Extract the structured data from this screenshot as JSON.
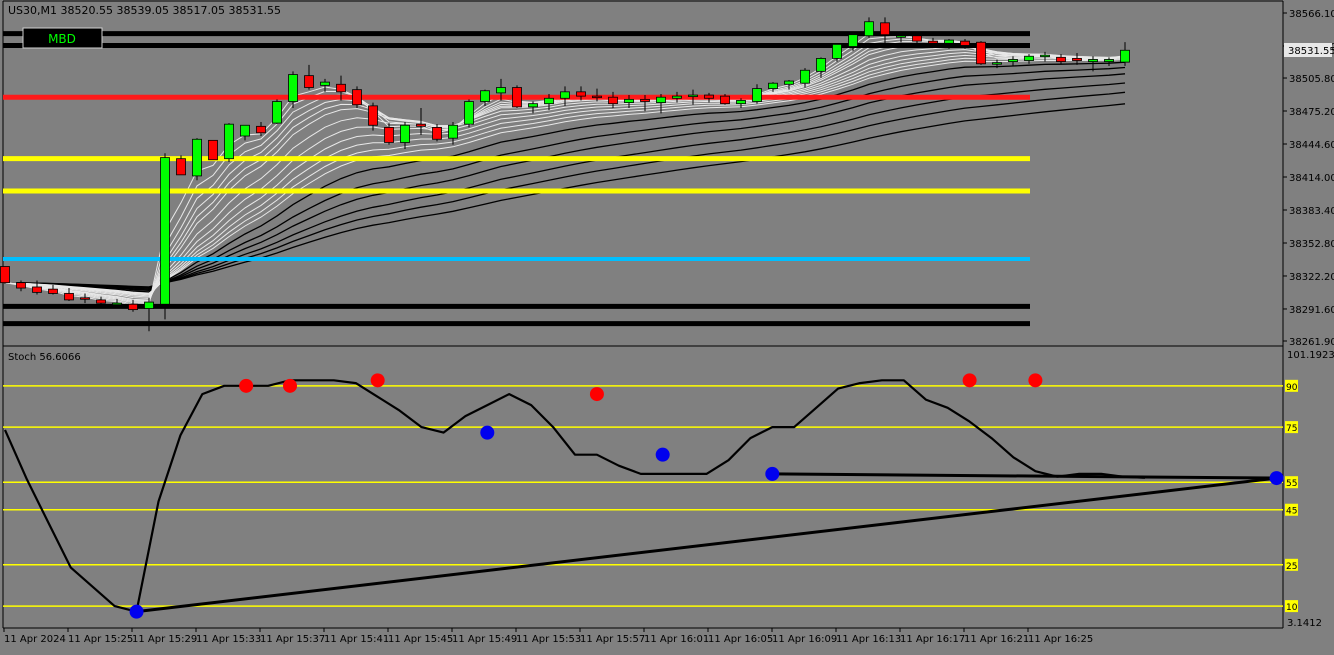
{
  "colors": {
    "background": "#808080",
    "bull_candle": "#00ff00",
    "bear_candle": "#ff0000",
    "level_red": "#ff1a1a",
    "level_yellow": "#ffff00",
    "level_cyan": "#00bfff",
    "level_black": "#000000",
    "ribbon_light": "#e8e8e8",
    "ribbon_dark": "#000000",
    "stoch_line": "#000000",
    "stoch_level": "#ffff00",
    "marker_high": "#ff0000",
    "marker_low": "#0000ee",
    "axis_text": "#000000"
  },
  "header": {
    "symbol_info": "US30,M1  38520.55 38539.05 38517.05 38531.55",
    "badge": "MBD"
  },
  "price_axis": {
    "labels": [
      "38566.10",
      "38535.50",
      "38505.80",
      "38475.20",
      "38444.60",
      "38414.00",
      "38383.40",
      "38352.80",
      "38322.20",
      "38291.60",
      "38261.90"
    ],
    "current_price": "38531.55"
  },
  "time_axis": {
    "labels": [
      "11 Apr 2024",
      "11 Apr 15:25",
      "11 Apr 15:29",
      "11 Apr 15:33",
      "11 Apr 15:37",
      "11 Apr 15:41",
      "11 Apr 15:45",
      "11 Apr 15:49",
      "11 Apr 15:53",
      "11 Apr 15:57",
      "11 Apr 16:01",
      "11 Apr 16:05",
      "11 Apr 16:09",
      "11 Apr 16:13",
      "11 Apr 16:17",
      "11 Apr 16:21",
      "11 Apr 16:25"
    ]
  },
  "stoch_panel": {
    "title": "Stoch 56.6066",
    "scale_top": "101.1923",
    "scale_bottom": "3.1412",
    "level_labels": [
      "90",
      "75",
      "55",
      "45",
      "25",
      "10"
    ]
  },
  "chart_data": {
    "type": "candlestick",
    "symbol": "US30",
    "timeframe": "M1",
    "y_range": [
      38261.9,
      38566.1
    ],
    "levels": [
      {
        "price": 38547.0,
        "color": "black"
      },
      {
        "price": 38536.0,
        "color": "black"
      },
      {
        "price": 38488.0,
        "color": "red"
      },
      {
        "price": 38431.0,
        "color": "yellow"
      },
      {
        "price": 38401.0,
        "color": "yellow"
      },
      {
        "price": 38338.0,
        "color": "cyan"
      },
      {
        "price": 38294.0,
        "color": "black"
      },
      {
        "price": 38278.0,
        "color": "black"
      }
    ],
    "candles": [
      [
        38331,
        38331,
        38315,
        38316
      ],
      [
        38316,
        38318,
        38308,
        38311
      ],
      [
        38312,
        38318,
        38305,
        38307
      ],
      [
        38310,
        38314,
        38305,
        38306
      ],
      [
        38306,
        38311,
        38299,
        38300
      ],
      [
        38302,
        38306,
        38297,
        38301
      ],
      [
        38300,
        38303,
        38295,
        38297
      ],
      [
        38297,
        38301,
        38293,
        38297
      ],
      [
        38296,
        38300,
        38289,
        38291
      ],
      [
        38292,
        38302,
        38271,
        38298
      ],
      [
        38296,
        38436,
        38282,
        38432
      ],
      [
        38431,
        38434,
        38416,
        38416
      ],
      [
        38415,
        38450,
        38411,
        38449
      ],
      [
        38448,
        38448,
        38431,
        38430
      ],
      [
        38431,
        38464,
        38428,
        38463
      ],
      [
        38452,
        38460,
        38448,
        38462
      ],
      [
        38461,
        38465,
        38452,
        38455
      ],
      [
        38464,
        38486,
        38463,
        38484
      ],
      [
        38484,
        38512,
        38478,
        38509
      ],
      [
        38508,
        38518,
        38495,
        38497
      ],
      [
        38499,
        38505,
        38493,
        38502
      ],
      [
        38500,
        38508,
        38485,
        38493
      ],
      [
        38495,
        38498,
        38478,
        38481
      ],
      [
        38480,
        38483,
        38457,
        38462
      ],
      [
        38460,
        38464,
        38444,
        38446
      ],
      [
        38446,
        38465,
        38440,
        38462
      ],
      [
        38463,
        38478,
        38453,
        38461
      ],
      [
        38460,
        38463,
        38447,
        38449
      ],
      [
        38450,
        38465,
        38444,
        38462
      ],
      [
        38463,
        38486,
        38460,
        38484
      ],
      [
        38484,
        38495,
        38480,
        38494
      ],
      [
        38492,
        38505,
        38485,
        38497
      ],
      [
        38497,
        38499,
        38478,
        38479
      ],
      [
        38479,
        38484,
        38473,
        38482
      ],
      [
        38482,
        38491,
        38476,
        38487
      ],
      [
        38487,
        38498,
        38480,
        38493
      ],
      [
        38493,
        38498,
        38485,
        38489
      ],
      [
        38489,
        38496,
        38484,
        38488
      ],
      [
        38488,
        38493,
        38478,
        38482
      ],
      [
        38483,
        38490,
        38478,
        38486
      ],
      [
        38486,
        38490,
        38475,
        38484
      ],
      [
        38483,
        38491,
        38473,
        38488
      ],
      [
        38487,
        38493,
        38483,
        38489
      ],
      [
        38489,
        38495,
        38481,
        38490
      ],
      [
        38490,
        38492,
        38483,
        38487
      ],
      [
        38489,
        38491,
        38481,
        38482
      ],
      [
        38482,
        38487,
        38478,
        38485
      ],
      [
        38484,
        38500,
        38482,
        38496
      ],
      [
        38496,
        38502,
        38493,
        38501
      ],
      [
        38500,
        38504,
        38495,
        38503
      ],
      [
        38501,
        38515,
        38497,
        38513
      ],
      [
        38512,
        38525,
        38506,
        38524
      ],
      [
        38524,
        38538,
        38521,
        38537
      ],
      [
        38535,
        38548,
        38531,
        38546
      ],
      [
        38545,
        38562,
        38543,
        38558
      ],
      [
        38557,
        38562,
        38537,
        38546
      ],
      [
        38545,
        38549,
        38539,
        38545
      ],
      [
        38545,
        38548,
        38536,
        38540
      ],
      [
        38540,
        38543,
        38534,
        38538
      ],
      [
        38538,
        38542,
        38533,
        38541
      ],
      [
        38540,
        38542,
        38533,
        38536
      ],
      [
        38539,
        38540,
        38518,
        38519
      ],
      [
        38520,
        38523,
        38515,
        38520
      ],
      [
        38521,
        38526,
        38517,
        38523
      ],
      [
        38522,
        38528,
        38519,
        38526
      ],
      [
        38526,
        38530,
        38521,
        38527
      ],
      [
        38525,
        38528,
        38519,
        38521
      ],
      [
        38524,
        38529,
        38518,
        38522
      ],
      [
        38521,
        38526,
        38512,
        38523
      ],
      [
        38521,
        38525,
        38517,
        38523
      ],
      [
        38520.55,
        38539.05,
        38517.05,
        38531.55
      ]
    ],
    "stochastic": {
      "name": "Stoch",
      "current": 56.6066,
      "y_range": [
        3.1412,
        101.1923
      ],
      "levels": [
        90,
        75,
        55,
        45,
        25,
        10
      ],
      "values": [
        74,
        56,
        40,
        24,
        17,
        10,
        8,
        48,
        72,
        87,
        90,
        90,
        90,
        92,
        92,
        92,
        91,
        86,
        81,
        75,
        73,
        79,
        83,
        87,
        83,
        75,
        65,
        65,
        61,
        58,
        58,
        58,
        58,
        63,
        71,
        75,
        75,
        82,
        89,
        91,
        92,
        92,
        85,
        82,
        77,
        71,
        64,
        59,
        57,
        58,
        58,
        57,
        56.6066
      ],
      "high_markers": [
        [
          11,
          90
        ],
        [
          13,
          90
        ],
        [
          17,
          92
        ],
        [
          27,
          87
        ],
        [
          44,
          92
        ],
        [
          47,
          92
        ]
      ],
      "low_markers": [
        [
          6,
          8
        ],
        [
          22,
          73
        ],
        [
          30,
          65
        ],
        [
          35,
          58
        ],
        [
          58,
          56.5
        ]
      ]
    }
  }
}
